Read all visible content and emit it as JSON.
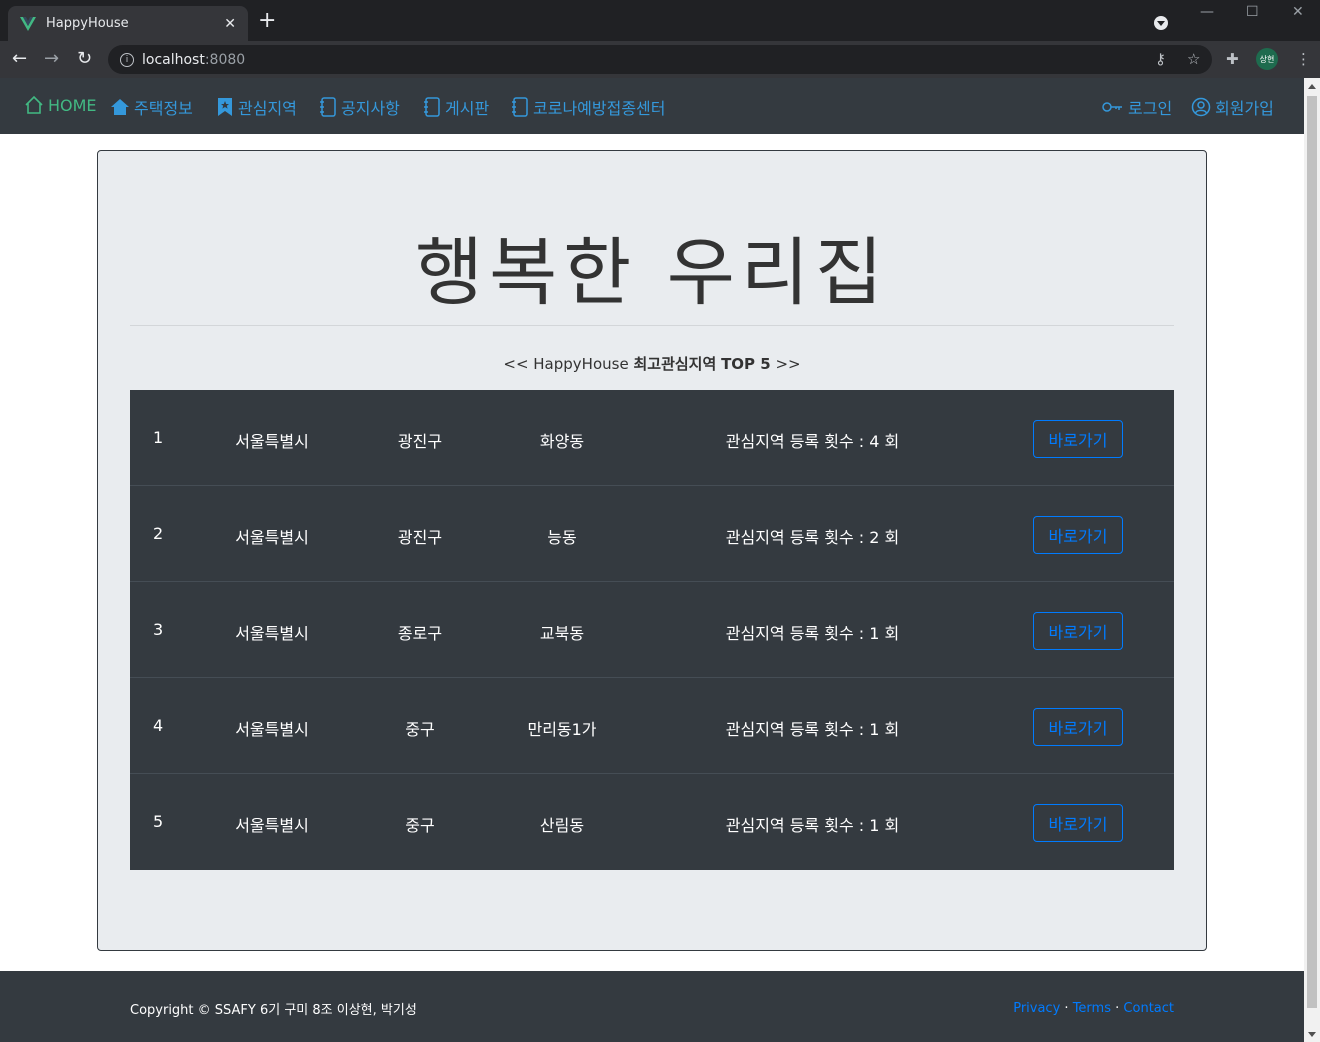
{
  "browser": {
    "tab_title": "HappyHouse",
    "tab_close": "✕",
    "new_tab": "+",
    "url_host": "localhost",
    "url_port": ":8080",
    "profile_initials": "상현"
  },
  "nav": {
    "home": "HOME",
    "house_info": "주택정보",
    "interest_area": "관심지역",
    "notice": "공지사항",
    "board": "게시판",
    "covid_center": "코로나예방접종센터",
    "login": "로그인",
    "signup": "회원가입"
  },
  "jumbotron": {
    "title": "행복한 우리집",
    "caption_prefix": "<< HappyHouse",
    "caption_bold1": "최고관심지역",
    "caption_bold2": "TOP 5",
    "caption_suffix": ">>"
  },
  "rankings": [
    {
      "rank": "1",
      "city": "서울특별시",
      "gu": "광진구",
      "dong": "화양동",
      "count_text": "관심지역 등록 횟수 : 4 회",
      "button": "바로가기"
    },
    {
      "rank": "2",
      "city": "서울특별시",
      "gu": "광진구",
      "dong": "능동",
      "count_text": "관심지역 등록 횟수 : 2 회",
      "button": "바로가기"
    },
    {
      "rank": "3",
      "city": "서울특별시",
      "gu": "종로구",
      "dong": "교북동",
      "count_text": "관심지역 등록 횟수 : 1 회",
      "button": "바로가기"
    },
    {
      "rank": "4",
      "city": "서울특별시",
      "gu": "중구",
      "dong": "만리동1가",
      "count_text": "관심지역 등록 횟수 : 1 회",
      "button": "바로가기"
    },
    {
      "rank": "5",
      "city": "서울특별시",
      "gu": "중구",
      "dong": "산림동",
      "count_text": "관심지역 등록 횟수 : 1 회",
      "button": "바로가기"
    }
  ],
  "footer": {
    "copyright": "Copyright © SSAFY 6기 구미 8조 이상현, 박기성",
    "privacy": "Privacy",
    "terms": "Terms",
    "contact": "Contact",
    "separator": "·"
  },
  "colors": {
    "nav_bg": "#343a40",
    "home_green": "#42b983",
    "link_blue": "#3498db",
    "button_blue": "#007bff",
    "jumbo_bg": "#e9ecef"
  }
}
